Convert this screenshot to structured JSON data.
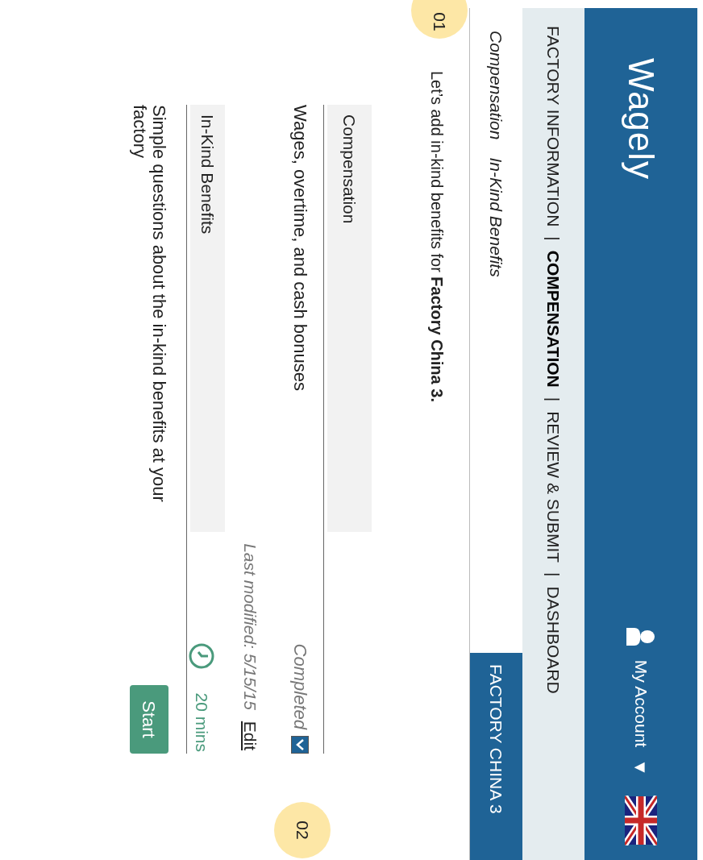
{
  "header": {
    "logo": "Wagely",
    "account": "My Account",
    "account_caret": "▼"
  },
  "nav": [
    {
      "kind": "link",
      "label": "FACTORY INFORMATION",
      "selected": false
    },
    {
      "kind": "separator",
      "label": "|"
    },
    {
      "kind": "link",
      "label": "COMPENSATION",
      "selected": true
    },
    {
      "kind": "separator",
      "label": "|"
    },
    {
      "kind": "link",
      "label": "REVIEW & SUBMIT",
      "selected": false
    },
    {
      "kind": "separator",
      "label": "|"
    },
    {
      "kind": "link",
      "label": "DASHBOARD",
      "selected": false
    }
  ],
  "breadcrumb": [
    {
      "label": "Compensation"
    },
    {
      "label": "In-Kind Benefits"
    }
  ],
  "factory_tab": "FACTORY CHINA 3",
  "step_markers": [
    {
      "label": "01"
    },
    {
      "label": "02"
    }
  ],
  "intro": "Let’s add in-kind benefits for **Factory China 3.**",
  "sections": [
    {
      "kind": "completed",
      "title": "Compensation",
      "description": "Wages, overtime, and cash bonuses",
      "status": "Completed",
      "checked": true,
      "modified": "Last modified: 5/15/15",
      "action": "Edit"
    },
    {
      "kind": "pending",
      "title": "In-Kind Benefits",
      "description": "Simple questions about the in-kind benefits at your factory",
      "duration": "20 mins",
      "action": "Start"
    }
  ]
}
